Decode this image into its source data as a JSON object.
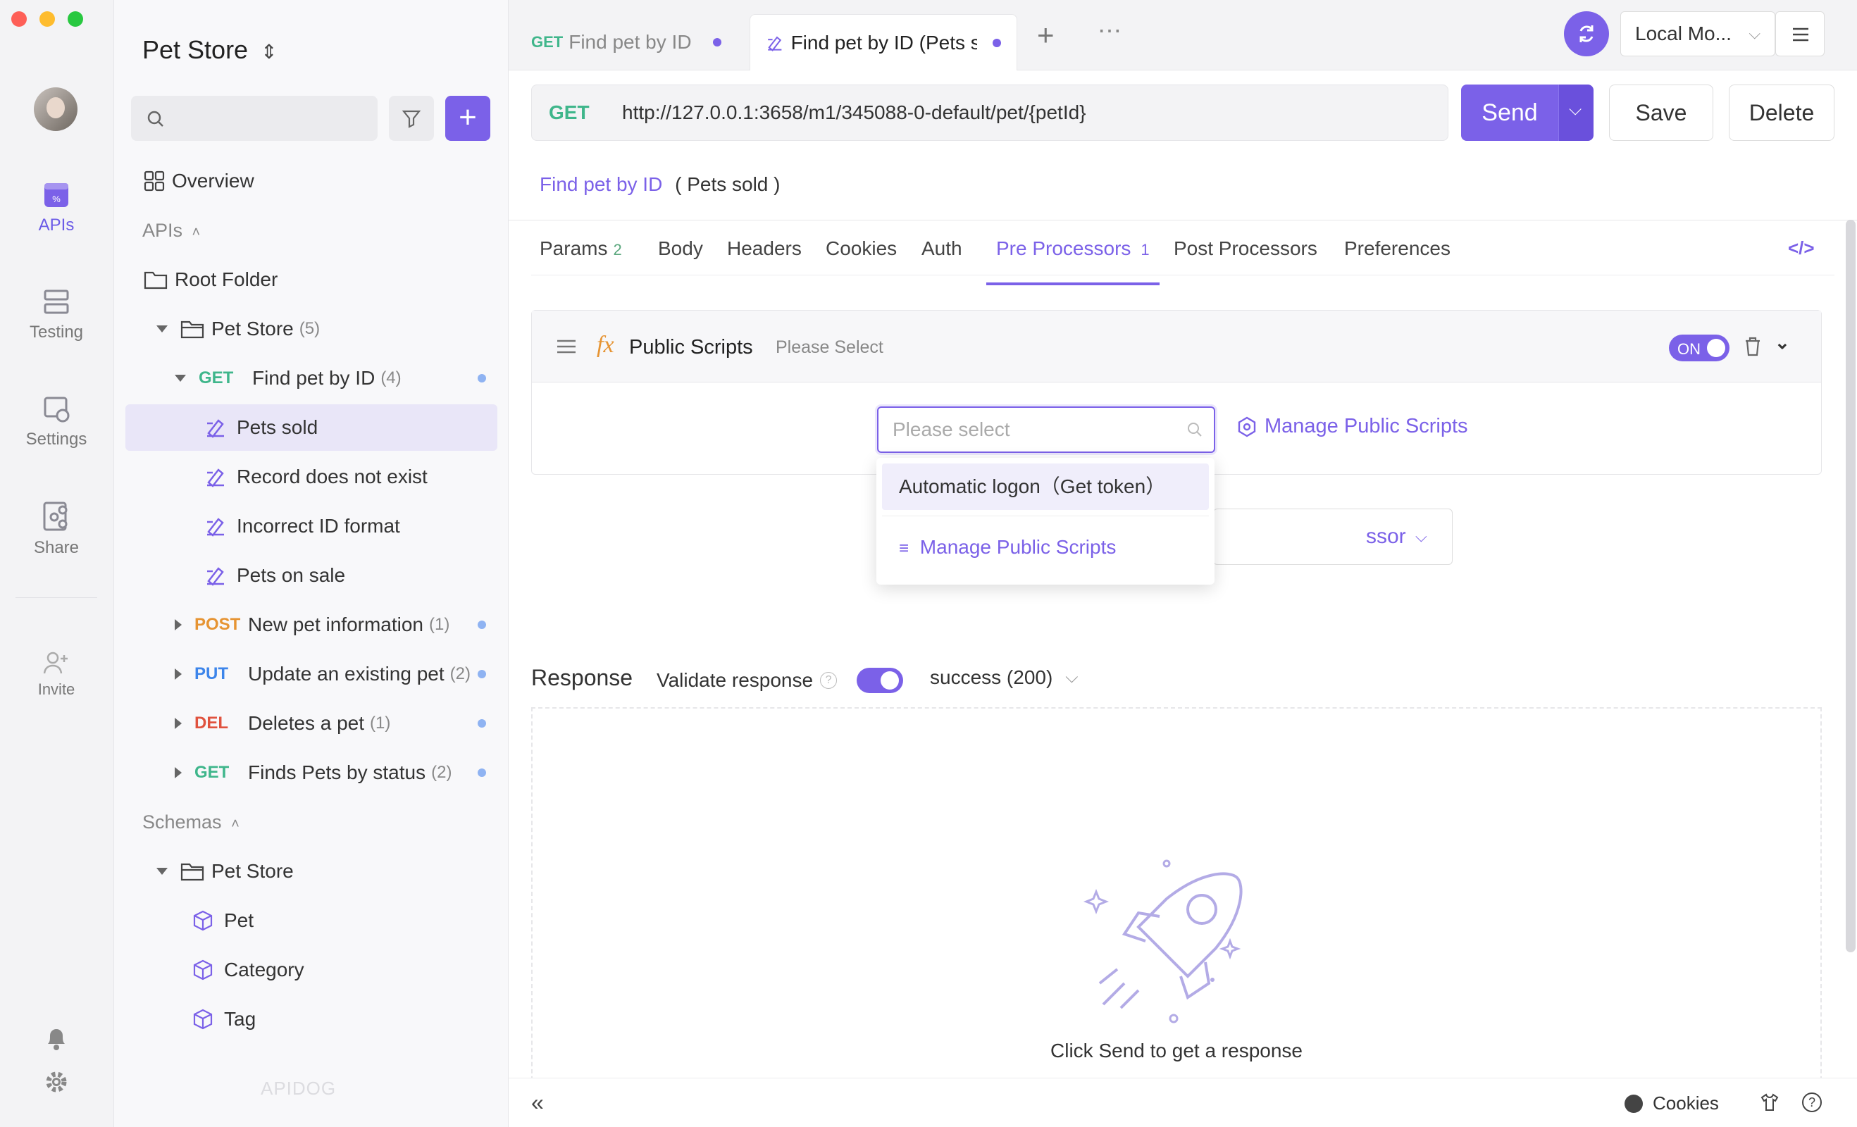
{
  "rail": {
    "items": [
      {
        "label": "APIs",
        "icon": "api-icon",
        "active": true
      },
      {
        "label": "Testing",
        "icon": "testing-icon",
        "active": false
      },
      {
        "label": "Settings",
        "icon": "settings-icon",
        "active": false
      },
      {
        "label": "Share",
        "icon": "share-icon",
        "active": false
      }
    ],
    "invite_label": "Invite"
  },
  "sidebar": {
    "project_title": "Pet Store",
    "overview_label": "Overview",
    "apis_section": "APIs",
    "root_folder": "Root Folder",
    "pet_store_folder": "Pet Store",
    "pet_store_count": "(5)",
    "apis": [
      {
        "method": "GET",
        "name": "Find pet by ID",
        "count": "(4)",
        "expanded": true
      },
      {
        "method": "POST",
        "name": "New pet information",
        "count": "(1)"
      },
      {
        "method": "PUT",
        "name": "Update an existing pet",
        "count": "(2)"
      },
      {
        "method": "DEL",
        "name": "Deletes a pet",
        "count": "(1)"
      },
      {
        "method": "GET",
        "name": "Finds Pets by status",
        "count": "(2)"
      }
    ],
    "cases": [
      "Pets sold",
      "Record does not exist",
      "Incorrect ID format",
      "Pets on sale"
    ],
    "schemas_section": "Schemas",
    "schema_folder": "Pet Store",
    "schemas": [
      "Pet",
      "Category",
      "Tag"
    ],
    "watermark": "APIDOG"
  },
  "tabs": [
    {
      "method": "GET",
      "label": "Find pet by ID",
      "active": false
    },
    {
      "label": "Find pet by ID (Pets s",
      "active": true
    }
  ],
  "toolbar": {
    "environment": "Local Mo...",
    "method": "GET",
    "url": "http://127.0.0.1:3658/m1/345088-0-default/pet/{petId}",
    "send_label": "Send",
    "save_label": "Save",
    "delete_label": "Delete"
  },
  "breadcrumb": {
    "api_link": "Find pet by ID",
    "case": "( Pets sold )"
  },
  "subtabs": [
    {
      "label": "Params",
      "badge": "2"
    },
    {
      "label": "Body",
      "badge": ""
    },
    {
      "label": "Headers",
      "badge": ""
    },
    {
      "label": "Cookies",
      "badge": ""
    },
    {
      "label": "Auth",
      "badge": ""
    },
    {
      "label": "Pre Processors",
      "badge": "1",
      "active": true
    },
    {
      "label": "Post Processors",
      "badge": ""
    },
    {
      "label": "Preferences",
      "badge": ""
    }
  ],
  "processor": {
    "fx_label": "fx",
    "title": "Public Scripts",
    "select_hint": "Please Select",
    "toggle_label": "ON",
    "select_placeholder": "Please select",
    "manage_label": "Manage Public Scripts",
    "add_processor_partial": "ssor"
  },
  "dropdown": {
    "option": "Automatic logon（Get token）",
    "manage_label": "Manage Public Scripts"
  },
  "response": {
    "title": "Response",
    "validate_label": "Validate response",
    "status": "success (200)",
    "hint": "Click Send to get a response"
  },
  "footer": {
    "cookies_label": "Cookies"
  },
  "colors": {
    "accent": "#7b61e8",
    "get": "#3fb68b",
    "post": "#e69433",
    "put": "#3d85ea",
    "del": "#e0523e"
  }
}
